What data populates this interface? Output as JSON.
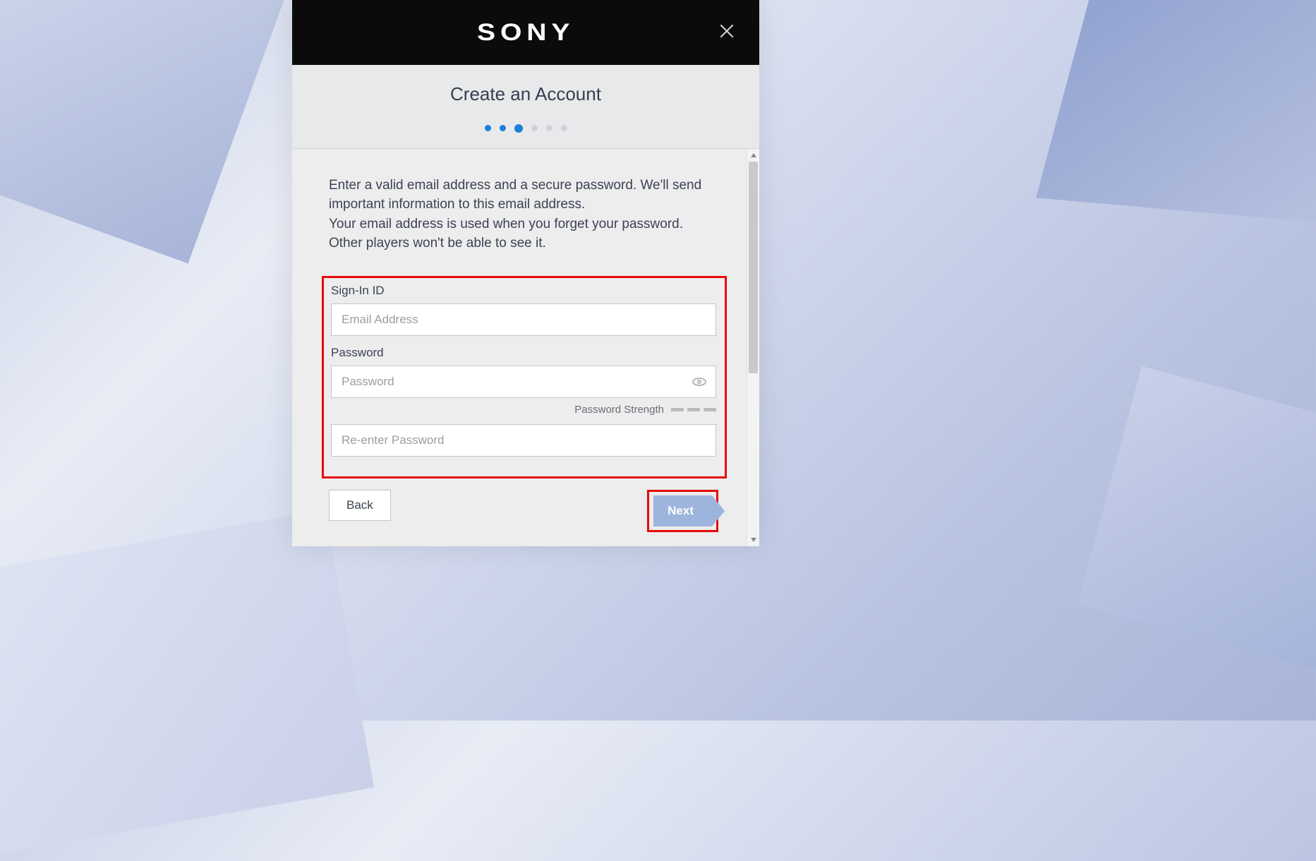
{
  "header": {
    "brand": "SONY"
  },
  "title": "Create an Account",
  "stepper": {
    "total": 6,
    "current_index": 2
  },
  "instructions": {
    "line1": "Enter a valid email address and a secure password. We'll send important information to this email address.",
    "line2": "Your email address is used when you forget your password. Other players won't be able to see it."
  },
  "form": {
    "signin_label": "Sign-In ID",
    "email_placeholder": "Email Address",
    "password_label": "Password",
    "password_placeholder": "Password",
    "strength_label": "Password Strength",
    "reenter_placeholder": "Re-enter Password"
  },
  "nav": {
    "back_label": "Back",
    "next_label": "Next"
  }
}
